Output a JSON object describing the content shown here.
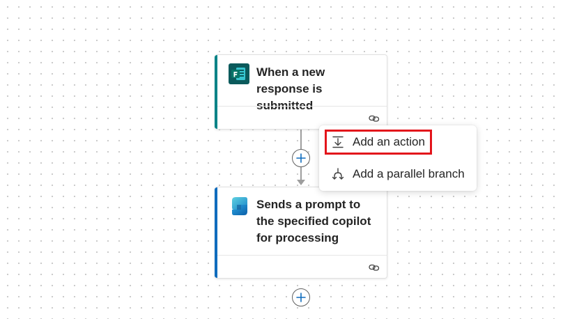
{
  "flow": {
    "trigger": {
      "title": "When a new response is submitted",
      "icon": "forms-icon",
      "accent_color": "#038387"
    },
    "action": {
      "title": "Sends a prompt to the specified copilot for processing",
      "icon": "copilot-studio-icon",
      "accent_color": "#0f6cbd"
    }
  },
  "insert_menu": {
    "items": [
      {
        "label": "Add an action",
        "icon": "add-action-icon",
        "highlighted": true
      },
      {
        "label": "Add a parallel branch",
        "icon": "parallel-branch-icon",
        "highlighted": false
      }
    ]
  },
  "colors": {
    "highlight": "#e3141b",
    "plus_button": "#0f6cbd"
  }
}
